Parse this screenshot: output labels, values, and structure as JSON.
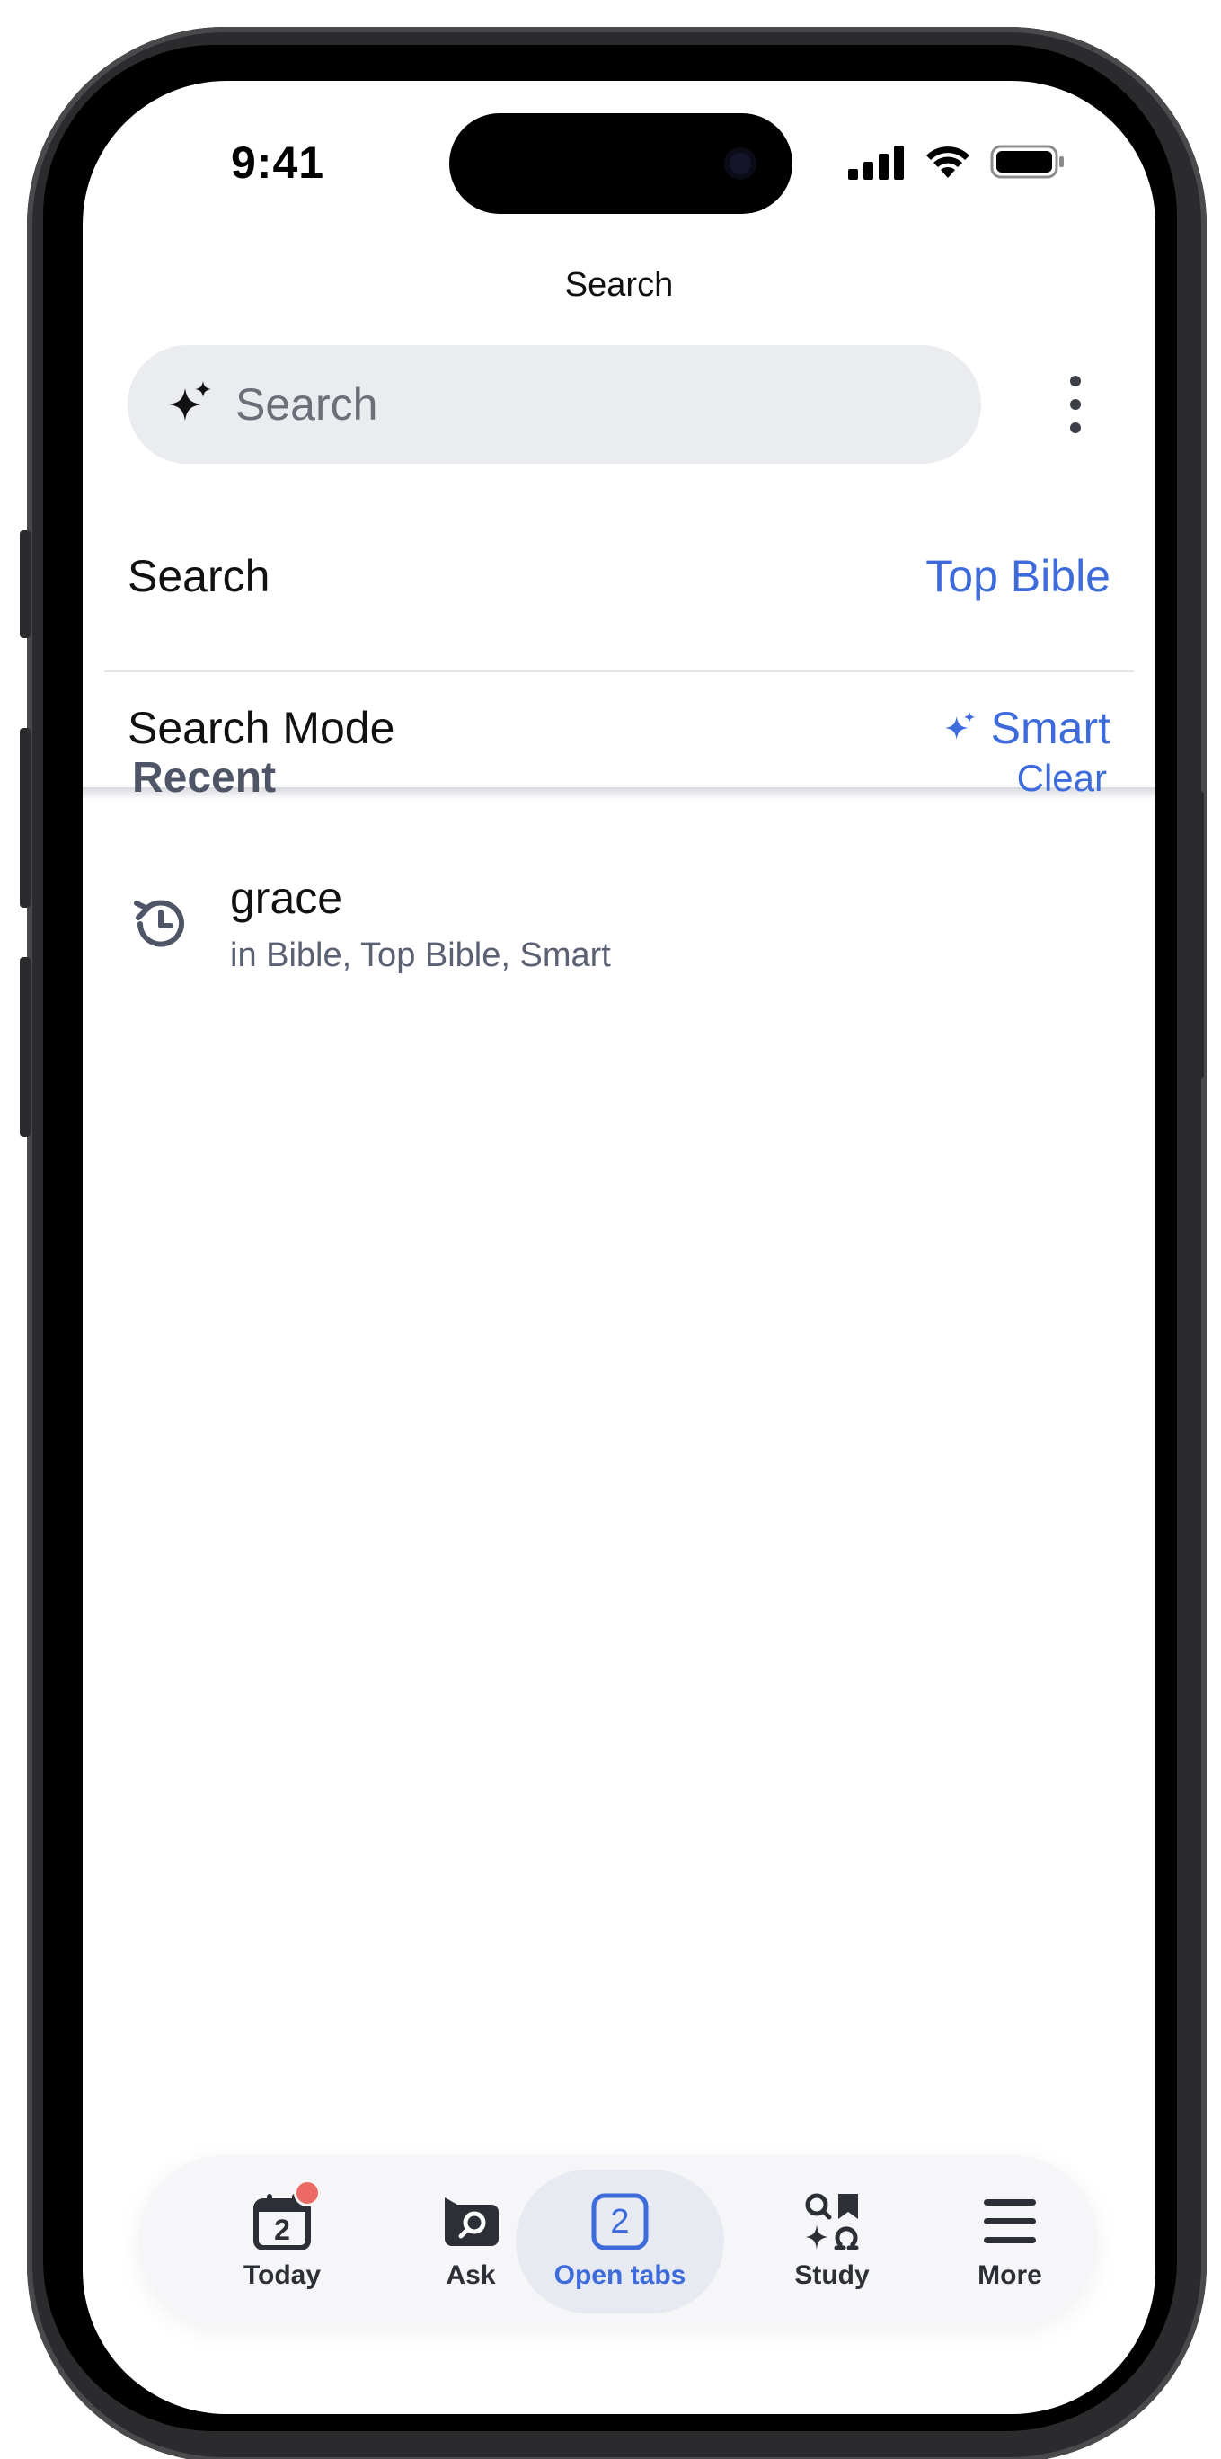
{
  "status_bar": {
    "time": "9:41"
  },
  "header": {
    "title": "Search",
    "search_placeholder": "Search"
  },
  "settings": {
    "search": {
      "label": "Search",
      "value": "Top Bible"
    },
    "search_mode": {
      "label": "Search Mode",
      "value": "Smart"
    }
  },
  "recent": {
    "title": "Recent",
    "clear_label": "Clear",
    "items": [
      {
        "term": "grace",
        "scope": "in Bible, Top Bible, Smart"
      }
    ]
  },
  "tabbar": {
    "tabs": [
      {
        "label": "Today",
        "icon": "calendar-icon",
        "badge_number": "2",
        "has_dot": true
      },
      {
        "label": "Ask",
        "icon": "chat-search-icon"
      },
      {
        "label": "Open tabs",
        "icon": "tabs-count-icon",
        "count": "2",
        "active": true
      },
      {
        "label": "Study",
        "icon": "study-grid-icon"
      },
      {
        "label": "More",
        "icon": "hamburger-icon"
      }
    ]
  },
  "colors": {
    "accent": "#3d6bdc",
    "badge": "#ec6a64",
    "search_bg": "#ebecf0"
  }
}
